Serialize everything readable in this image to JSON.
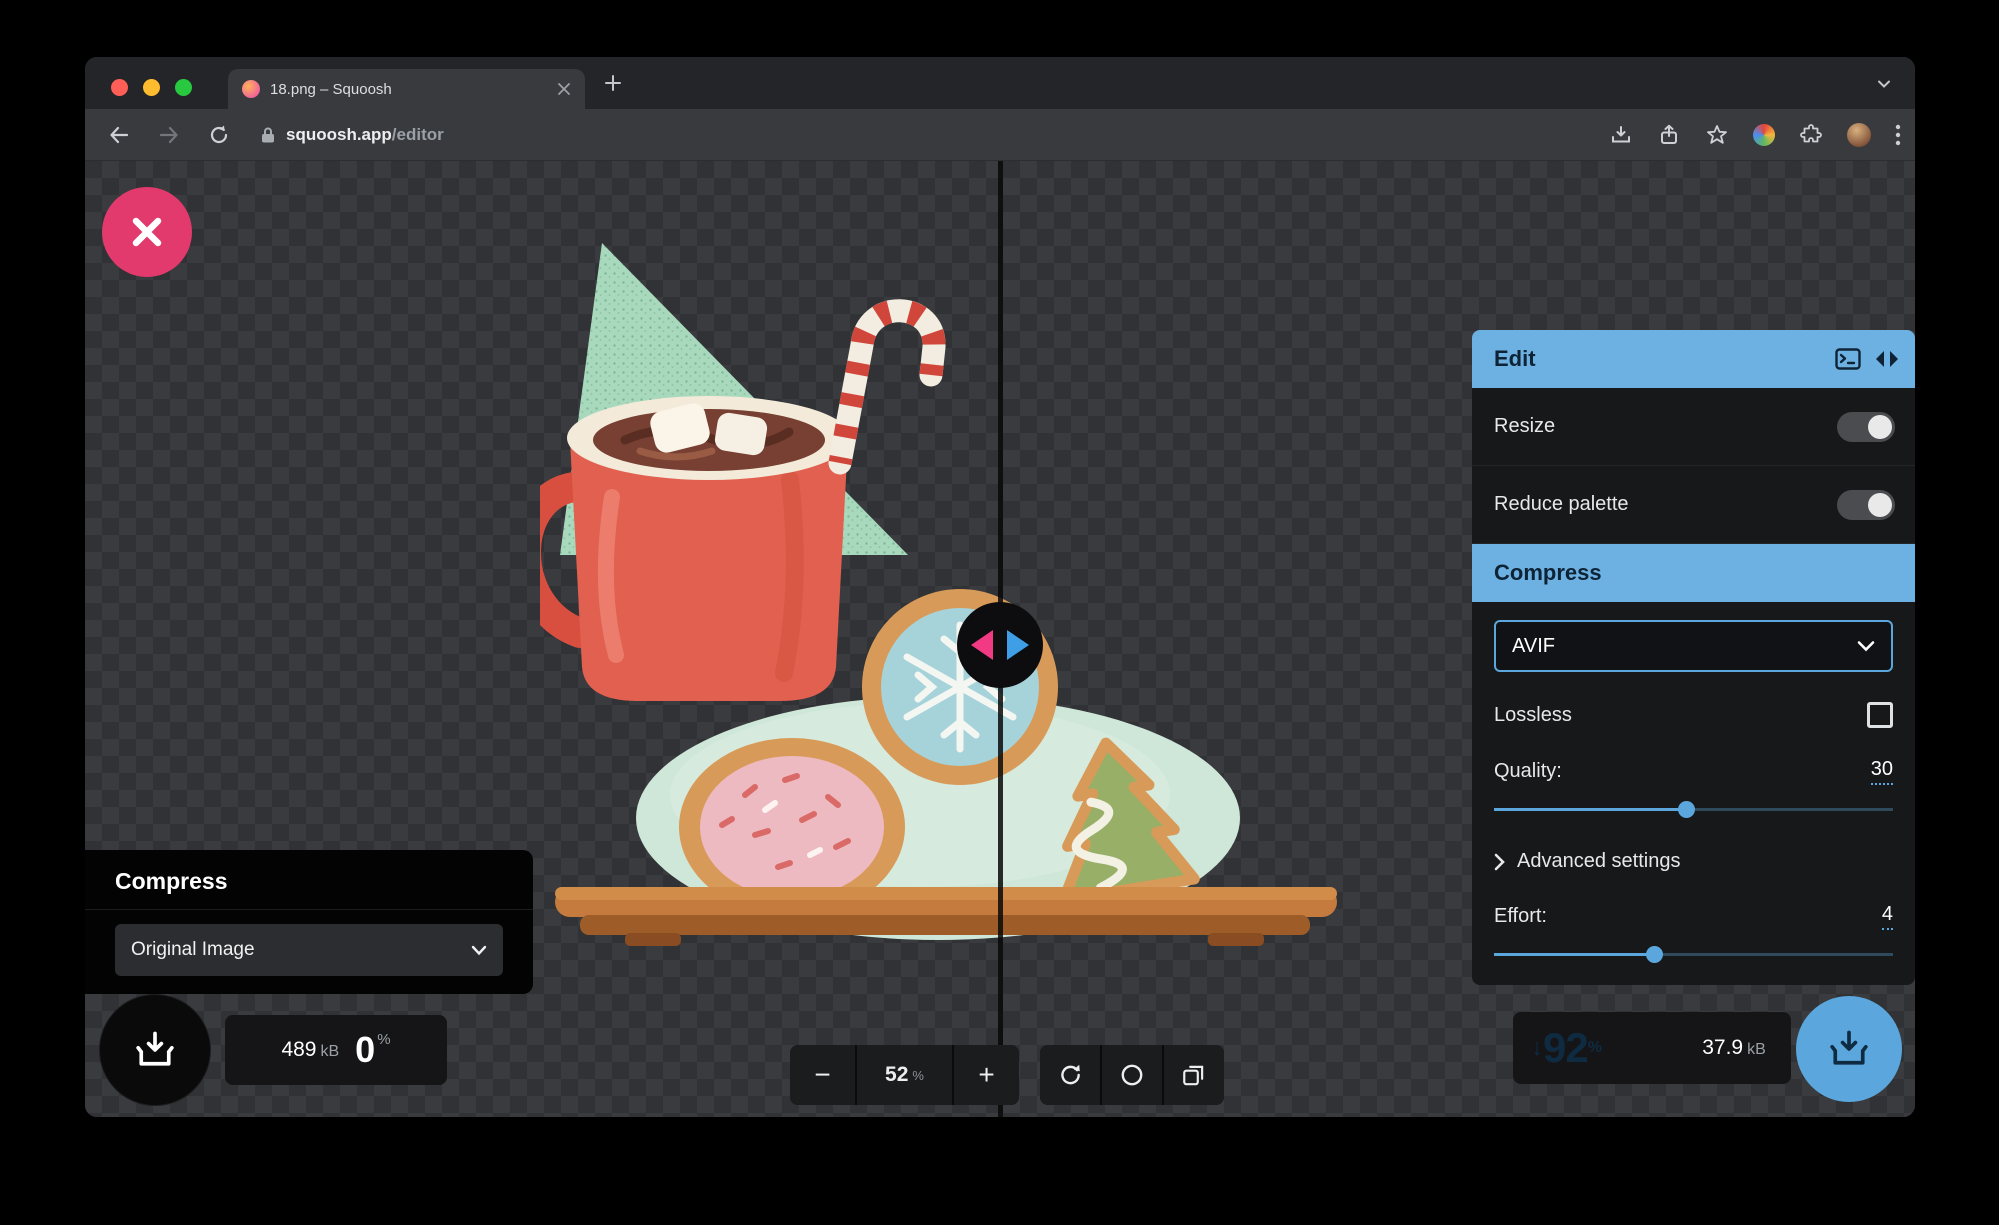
{
  "colors": {
    "accent": "#5ba7dd",
    "header_blue": "#6db1e2",
    "close_pink": "#e23a6d",
    "handle_pink": "#f23983",
    "handle_blue": "#3e9ee6"
  },
  "browser": {
    "tab_title": "18.png – Squoosh",
    "url_host": "squoosh.app",
    "url_path": "/editor"
  },
  "left_panel": {
    "title": "Compress",
    "image_select": "Original Image",
    "size_value": "489",
    "size_unit": "kB",
    "delta_value": "0",
    "delta_unit": "%"
  },
  "zoom": {
    "out": "−",
    "value": "52",
    "unit": "%",
    "in": "+"
  },
  "edit_panel": {
    "title": "Edit",
    "resize_label": "Resize",
    "reduce_palette_label": "Reduce palette",
    "compress_title": "Compress",
    "codec": "AVIF",
    "lossless_label": "Lossless",
    "quality_label": "Quality:",
    "quality_value": "30",
    "quality_slider_pct": 48,
    "advanced_label": "Advanced settings",
    "effort_label": "Effort:",
    "effort_value": "4",
    "effort_slider_pct": 40
  },
  "results": {
    "arrow": "↓",
    "delta_value": "92",
    "delta_unit": "%",
    "size_value": "37.9",
    "size_unit": "kB"
  }
}
